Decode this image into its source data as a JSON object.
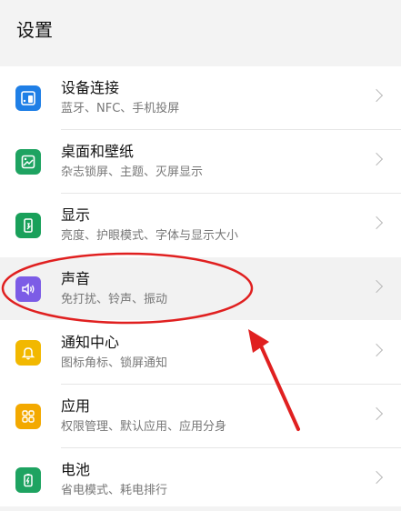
{
  "header": {
    "title": "设置"
  },
  "items": [
    {
      "name": "设备连接",
      "sub": "蓝牙、NFC、手机投屏",
      "color": "#1f7fe6",
      "icon": "device-connection-icon"
    },
    {
      "name": "桌面和壁纸",
      "sub": "杂志锁屏、主题、灭屏显示",
      "color": "#1ea361",
      "icon": "wallpaper-icon"
    },
    {
      "name": "显示",
      "sub": "亮度、护眼模式、字体与显示大小",
      "color": "#19a05a",
      "icon": "display-icon"
    },
    {
      "name": "声音",
      "sub": "免打扰、铃声、振动",
      "color": "#7c5ce6",
      "icon": "speaker-icon"
    },
    {
      "name": "通知中心",
      "sub": "图标角标、锁屏通知",
      "color": "#f2b800",
      "icon": "bell-icon"
    },
    {
      "name": "应用",
      "sub": "权限管理、默认应用、应用分身",
      "color": "#f3a900",
      "icon": "apps-grid-icon"
    },
    {
      "name": "电池",
      "sub": "省电模式、耗电排行",
      "color": "#1ea361",
      "icon": "battery-icon"
    }
  ],
  "annotation_color": "#e02020"
}
